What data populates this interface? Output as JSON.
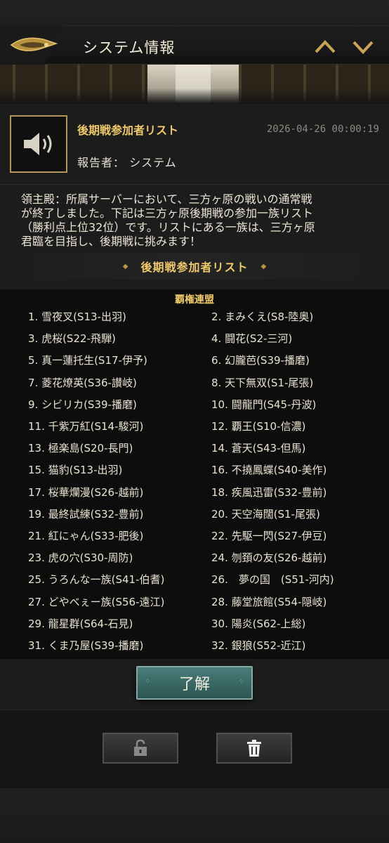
{
  "header": {
    "title": "システム情報"
  },
  "message": {
    "title": "後期戦参加者リスト",
    "timestamp": "2026-04-26 00:00:19",
    "reporter_label": "報告者：",
    "reporter": "システム",
    "body_lines": [
      "領主殿：所属サーバーにおいて、三方ヶ原の戦いの通常戦",
      "が終了しました。下記は三方ヶ原後期戦の参加一族リスト",
      "（勝利点上位32位）です。リストにある一族は、三方ヶ原",
      "君臨を目指し、後期戦に挑みます！"
    ],
    "list_heading": "後期戦参加者リスト"
  },
  "alliance": {
    "name": "覇権連盟"
  },
  "clans": [
    "1. 雪夜叉(S13-出羽)",
    "2. まみくえ(S8-陸奥)",
    "3. 虎桜(S22-飛騨)",
    "4. 闘花(S2-三河)",
    "5. 真一蓮托生(S17-伊予)",
    "6. 幻朧芭(S39-播磨)",
    "7. 菱花燎英(S36-讃岐)",
    "8. 天下無双(S1-尾張)",
    "9. シビリカ(S39-播磨)",
    "10. 闘龍門(S45-丹波)",
    "11. 千紫万紅(S14-駿河)",
    "12. 覇王(S10-信濃)",
    "13. 極楽島(S20-長門)",
    "14. 蒼天(S43-但馬)",
    "15. 猫豹(S13-出羽)",
    "16. 不撓鳳蝶(S40-美作)",
    "17. 桜華爛漫(S26-越前)",
    "18. 疾風迅雷(S32-豊前)",
    "19. 最終試練(S32-豊前)",
    "20. 天空海闊(S1-尾張)",
    "21. 紅にゃん(S33-肥後)",
    "22. 先駆一閃(S27-伊豆)",
    "23. 虎の穴(S30-周防)",
    "24. 刎頚の友(S26-越前)",
    "25. うろんな一族(S41-伯耆)",
    "26.　夢の国　(S51-河内)",
    "27. どやべぇー族(S56-遠江)",
    "28. 藤堂旅館(S54-隠岐)",
    "29. 龍星群(S64-石見)",
    "30. 陽炎(S62-上総)",
    "31. くま乃屋(S39-播磨)",
    "32. 銀狼(S52-近江)"
  ],
  "buttons": {
    "ok_label": "了解"
  },
  "icons": {
    "speaker": "speaker-icon",
    "lock": "unlock-icon",
    "trash": "trash-icon",
    "up": "chevron-up-icon",
    "down": "chevron-down-icon"
  },
  "colors": {
    "accent_gold": "#f0c96b",
    "button_teal": "#3f706c"
  }
}
